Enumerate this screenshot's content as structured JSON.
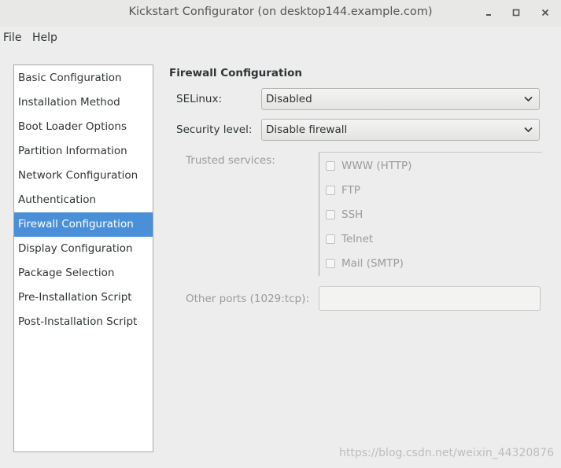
{
  "window": {
    "title": "Kickstart Configurator (on desktop144.example.com)",
    "controls": [
      "minimize",
      "maximize",
      "close"
    ]
  },
  "menubar": {
    "items": [
      "File",
      "Help"
    ]
  },
  "sidebar": {
    "items": [
      "Basic Configuration",
      "Installation Method",
      "Boot Loader Options",
      "Partition Information",
      "Network Configuration",
      "Authentication",
      "Firewall Configuration",
      "Display Configuration",
      "Package Selection",
      "Pre-Installation Script",
      "Post-Installation Script"
    ],
    "selected": "Firewall Configuration"
  },
  "firewall": {
    "section_title": "Firewall Configuration",
    "selinux_label": "SELinux:",
    "selinux_value": "Disabled",
    "security_label": "Security level:",
    "security_value": "Disable firewall",
    "trusted_label": "Trusted services:",
    "services": [
      "WWW (HTTP)",
      "FTP",
      "SSH",
      "Telnet",
      "Mail (SMTP)"
    ],
    "other_ports_label": "Other ports (1029:tcp):",
    "other_ports_value": ""
  },
  "watermark": "https://blog.csdn.net/weixin_44320876",
  "colors": {
    "selection": "#4a90d9",
    "background": "#ededed",
    "disabled_text": "#9a9c99"
  }
}
